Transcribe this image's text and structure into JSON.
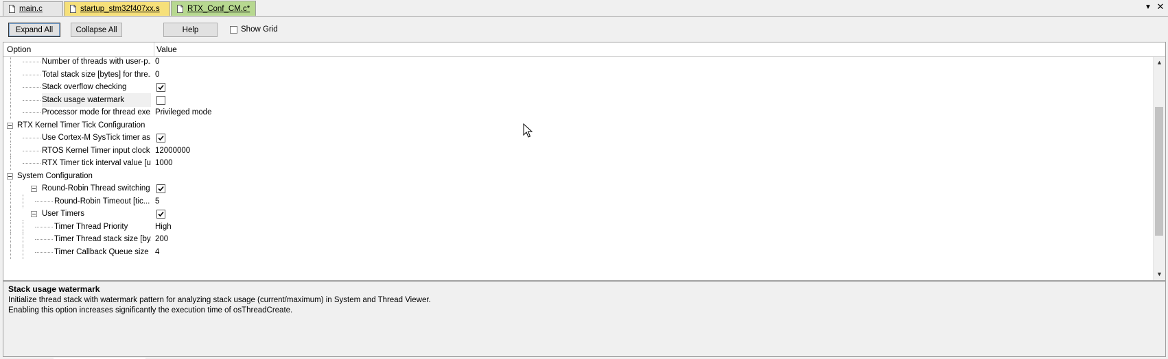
{
  "tabs": [
    {
      "label": "main.c"
    },
    {
      "label": "startup_stm32f407xx.s"
    },
    {
      "label": "RTX_Conf_CM.c*"
    }
  ],
  "icons": {
    "file": "file-icon",
    "dropdown": "chevron-down-icon",
    "close": "close-icon",
    "cursor": "mouse-pointer-icon"
  },
  "toolbar": {
    "expand_all": "Expand All",
    "collapse_all": "Collapse All",
    "help": "Help",
    "show_grid": "Show Grid",
    "show_grid_checked": false
  },
  "grid": {
    "columns": [
      "Option",
      "Value"
    ],
    "rows": [
      {
        "option": "Number of threads with user-p...",
        "value": "0",
        "level": 1
      },
      {
        "option": "Total stack size [bytes] for thre...",
        "value": "0",
        "level": 1
      },
      {
        "option": "Stack overflow checking",
        "value": "",
        "checkbox": true,
        "checked": true,
        "level": 1
      },
      {
        "option": "Stack usage watermark",
        "value": "",
        "checkbox": true,
        "checked": false,
        "level": 1,
        "selected": true
      },
      {
        "option": "Processor mode for thread exe...",
        "value": "Privileged mode",
        "level": 1
      },
      {
        "option": "RTX Kernel Timer Tick Configuration",
        "value": "",
        "level": 0,
        "group": true
      },
      {
        "option": "Use Cortex-M SysTick timer as ...",
        "value": "",
        "checkbox": true,
        "checked": true,
        "level": 1
      },
      {
        "option": "RTOS Kernel Timer input clock ...",
        "value": "12000000",
        "level": 1
      },
      {
        "option": "RTX Timer tick interval value [u...",
        "value": "1000",
        "level": 1
      },
      {
        "option": "System Configuration",
        "value": "",
        "level": 0,
        "group": true
      },
      {
        "option": "Round-Robin Thread switching",
        "value": "",
        "checkbox": true,
        "checked": true,
        "level": 1,
        "group": true
      },
      {
        "option": "Round-Robin Timeout [tic...",
        "value": "5",
        "level": 2
      },
      {
        "option": "User Timers",
        "value": "",
        "checkbox": true,
        "checked": true,
        "level": 1,
        "group": true
      },
      {
        "option": "Timer Thread Priority",
        "value": "High",
        "level": 2
      },
      {
        "option": "Timer Thread stack size [by...",
        "value": "200",
        "level": 2
      },
      {
        "option": "Timer Callback Queue size",
        "value": "4",
        "level": 2
      }
    ]
  },
  "description": {
    "title": "Stack usage watermark",
    "line1": "Initialize thread stack with watermark pattern for analyzing stack usage (current/maximum) in System and Thread Viewer.",
    "line2": "Enabling this option increases significantly the execution time of osThreadCreate."
  }
}
